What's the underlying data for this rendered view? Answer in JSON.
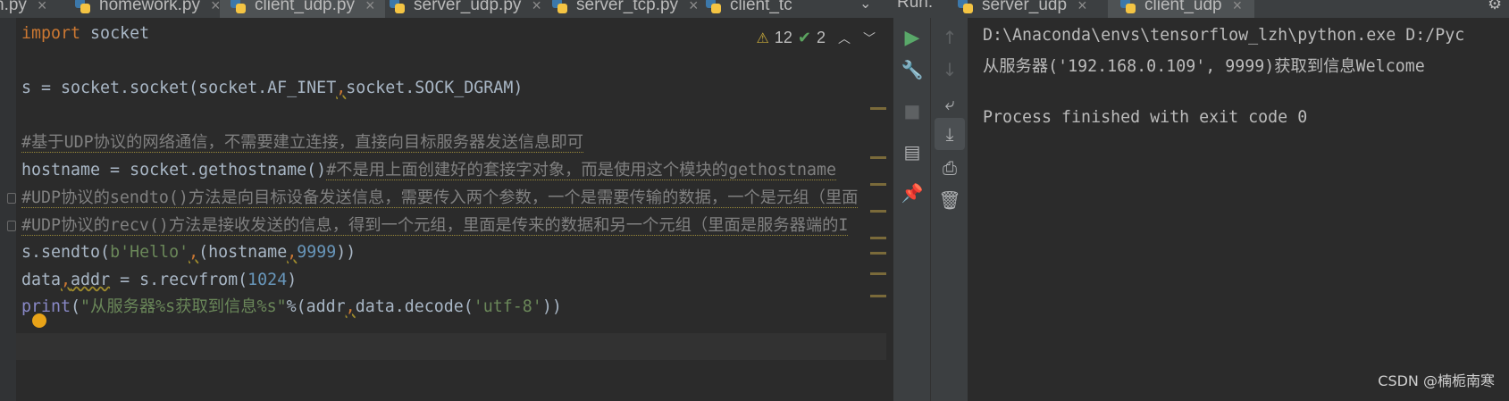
{
  "tabs": [
    {
      "label": "n.py",
      "icon": "python-file-icon",
      "active": false
    },
    {
      "label": "homework.py",
      "icon": "python-file-icon",
      "active": false
    },
    {
      "label": "client_udp.py",
      "icon": "python-file-icon",
      "active": true
    },
    {
      "label": "server_udp.py",
      "icon": "python-file-icon",
      "active": false
    },
    {
      "label": "server_tcp.py",
      "icon": "python-file-icon",
      "active": false
    },
    {
      "label": "client_tc",
      "icon": "python-file-icon",
      "active": false
    }
  ],
  "tab_more": "⌄",
  "run_panel": {
    "label": "Run:",
    "tabs": [
      {
        "label": "server_udp",
        "icon": "python-run-icon"
      },
      {
        "label": "client_udp",
        "icon": "python-run-icon"
      }
    ]
  },
  "inspections": {
    "warnings": "12",
    "weak_warnings": "2"
  },
  "code": {
    "l1_kw": "import",
    "l1_rest": " socket",
    "l3_a": "s = socket.socket(socket.AF_INET",
    "l3_comma": ",",
    "l3_b": "socket.SOCK_DGRAM)",
    "l5": "#基于UDP协议的网络通信，不需要建立连接，直接向目标服务器发送信息即可",
    "l6_a": "hostname = socket.gethostname()",
    "l6_cmt": "#不是用上面创建好的套接字对象，而是使用这个模块的gethostname",
    "l7": "#UDP协议的sendto()方法是向目标设备发送信息，需要传入两个参数，一个是需要传输的数据，一个是元组（里面",
    "l8": "#UDP协议的recv()方法是接收发送的信息，得到一个元组，里面是传来的数据和另一个元组（里面是服务器端的I",
    "l9_a": "s.sendto(",
    "l9_str": "b'Hello'",
    "l9_comma": ",",
    "l9_b": "(hostname",
    "l9_comma2": ",",
    "l9_num": "9999",
    "l9_c": "))",
    "l10_a": "data",
    "l10_comma": ",",
    "l10_b": "addr",
    "l10_c": " = s.recvfrom(",
    "l10_num": "1024",
    "l10_d": ")",
    "l11_builtin": "print",
    "l11_a": "(",
    "l11_str": "\"从服务器%s获取到信息%s\"",
    "l11_b": "%(addr",
    "l11_comma": ",",
    "l11_c": "data.decode(",
    "l11_str2": "'utf-8'",
    "l11_d": "))"
  },
  "console": {
    "line1": "D:\\Anaconda\\envs\\tensorflow_lzh\\python.exe D:/Pyc",
    "line2": "从服务器('192.168.0.109', 9999)获取到信息Welcome",
    "line4": "Process finished with exit code 0"
  },
  "watermark": "CSDN @楠栀南寒",
  "colors": {
    "keyword": "#cc7832",
    "string": "#6a8759",
    "number": "#6897bb",
    "comment": "#808080",
    "run_green": "#59a869"
  }
}
